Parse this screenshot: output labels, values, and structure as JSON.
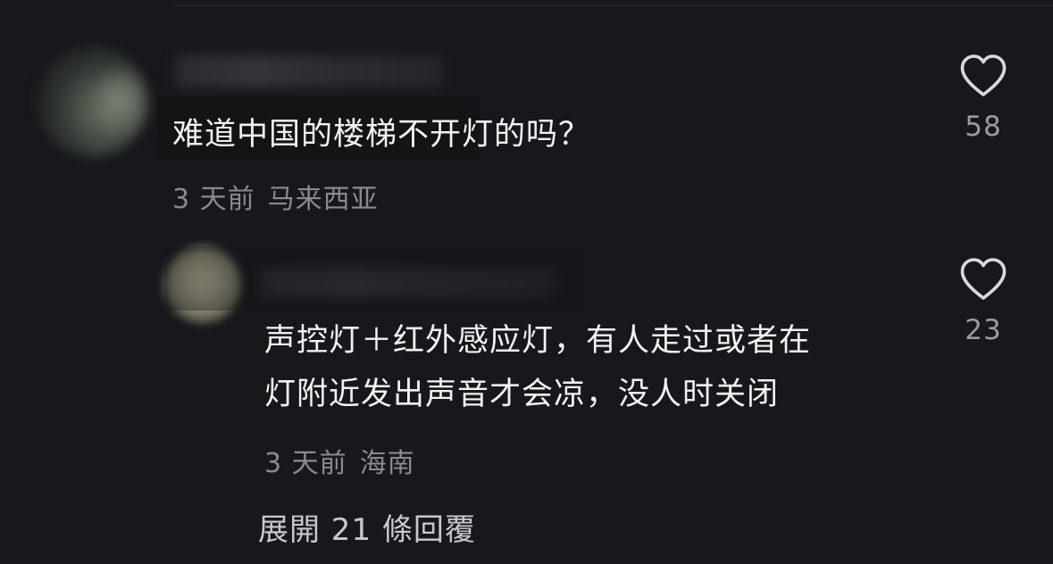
{
  "comments": [
    {
      "text": "难道中国的楼梯不开灯的吗？",
      "time": "3 天前",
      "location": "马来西亚",
      "likes": "58"
    },
    {
      "text_lines": [
        "声控灯＋红外感应灯，有人走过或者在",
        "灯附近发出声音才会凉，没人时关闭"
      ],
      "time": "3 天前",
      "location": "海南",
      "likes": "23"
    }
  ],
  "expand_replies_label": "展開 21 條回覆",
  "icons": {
    "like": "heart-outline-icon"
  },
  "colors": {
    "background": "#18181c",
    "text": "#f2f2f2",
    "meta": "#8a8a8f",
    "like_count": "#9a9aa0",
    "expand_link": "#c9c9cc"
  }
}
